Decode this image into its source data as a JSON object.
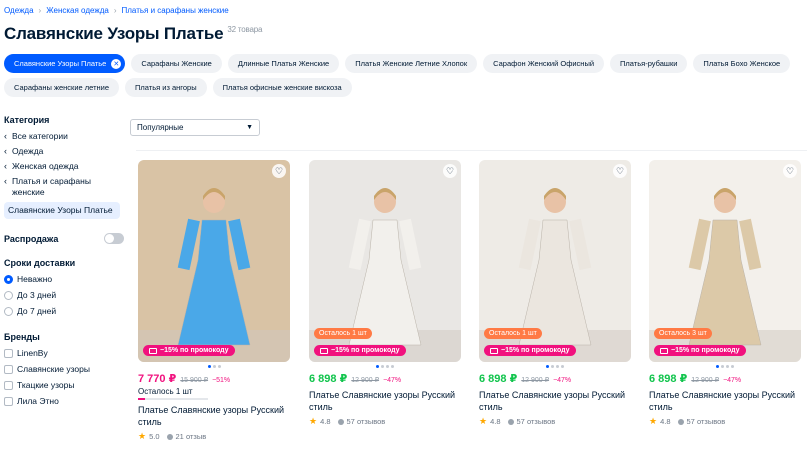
{
  "breadcrumb": [
    "Одежда",
    "Женская одежда",
    "Платья и сарафаны женские"
  ],
  "title": "Славянские Узоры Платье",
  "count": "32 товара",
  "chips": [
    {
      "label": "Славянские Узоры Платье",
      "active": true
    },
    {
      "label": "Сарафаны Женские"
    },
    {
      "label": "Длинные Платья Женские"
    },
    {
      "label": "Платья Женские Летние Хлопок"
    },
    {
      "label": "Сарафон Женский Офисный"
    },
    {
      "label": "Платья-рубашки"
    },
    {
      "label": "Платья Бохо Женское"
    },
    {
      "label": "Сарафаны женские летние"
    },
    {
      "label": "Платья из ангоры"
    },
    {
      "label": "Платья офисные женские вискоза"
    }
  ],
  "sidebar": {
    "category_heading": "Категория",
    "categories": [
      "Все категории",
      "Одежда",
      "Женская одежда",
      "Платья и сарафаны женские"
    ],
    "selected_category": "Славянские Узоры Платье",
    "sale_label": "Распродажа",
    "delivery_heading": "Сроки доставки",
    "delivery_options": [
      {
        "label": "Неважно",
        "selected": true
      },
      {
        "label": "До 3 дней",
        "selected": false
      },
      {
        "label": "До 7 дней",
        "selected": false
      }
    ],
    "brands_heading": "Бренды",
    "brands": [
      "LinenBy",
      "Славянские узоры",
      "Ткацкие узоры",
      "Лила Этно"
    ]
  },
  "sort": {
    "selected": "Популярные"
  },
  "products": [
    {
      "price": "7 770 ₽",
      "old_price": "15 900 ₽",
      "discount": "−51%",
      "promo": "−15% по промокоду",
      "stock_badge": "",
      "stock_note": "Осталось 1 шт",
      "stock_level": 0.1,
      "title": "Платье Славянские узоры Русский стиль",
      "rating": "5.0",
      "reviews": "21 отзыв",
      "price_color": "#f1117e",
      "dress_color": "#4aa8e8",
      "bg_color": "#d9c3a5",
      "slides": 3,
      "active_slide": 0
    },
    {
      "price": "6 898 ₽",
      "old_price": "12 900 ₽",
      "discount": "−47%",
      "promo": "−15% по промокоду",
      "stock_badge": "Осталось 1 шт",
      "stock_note": "",
      "title": "Платье Славянские узоры Русский стиль",
      "rating": "4.8",
      "reviews": "57 отзывов",
      "price_color": "#10c44c",
      "dress_color": "#f2f0ec",
      "bg_color": "#e9e7e4",
      "slides": 4,
      "active_slide": 0
    },
    {
      "price": "6 898 ₽",
      "old_price": "12 900 ₽",
      "discount": "−47%",
      "promo": "−15% по промокоду",
      "stock_badge": "Осталось 1 шт",
      "stock_note": "",
      "title": "Платье Славянские узоры Русский стиль",
      "rating": "4.8",
      "reviews": "57 отзывов",
      "price_color": "#10c44c",
      "dress_color": "#ebe6df",
      "bg_color": "#eeebe6",
      "slides": 4,
      "active_slide": 0
    },
    {
      "price": "6 898 ₽",
      "old_price": "12 900 ₽",
      "discount": "−47%",
      "promo": "−15% по промокоду",
      "stock_badge": "Осталось 3 шт",
      "stock_note": "",
      "title": "Платье Славянские узоры Русский стиль",
      "rating": "4.8",
      "reviews": "57 отзывов",
      "price_color": "#10c44c",
      "dress_color": "#dcc9a8",
      "bg_color": "#f3f0eb",
      "slides": 4,
      "active_slide": 0
    }
  ]
}
